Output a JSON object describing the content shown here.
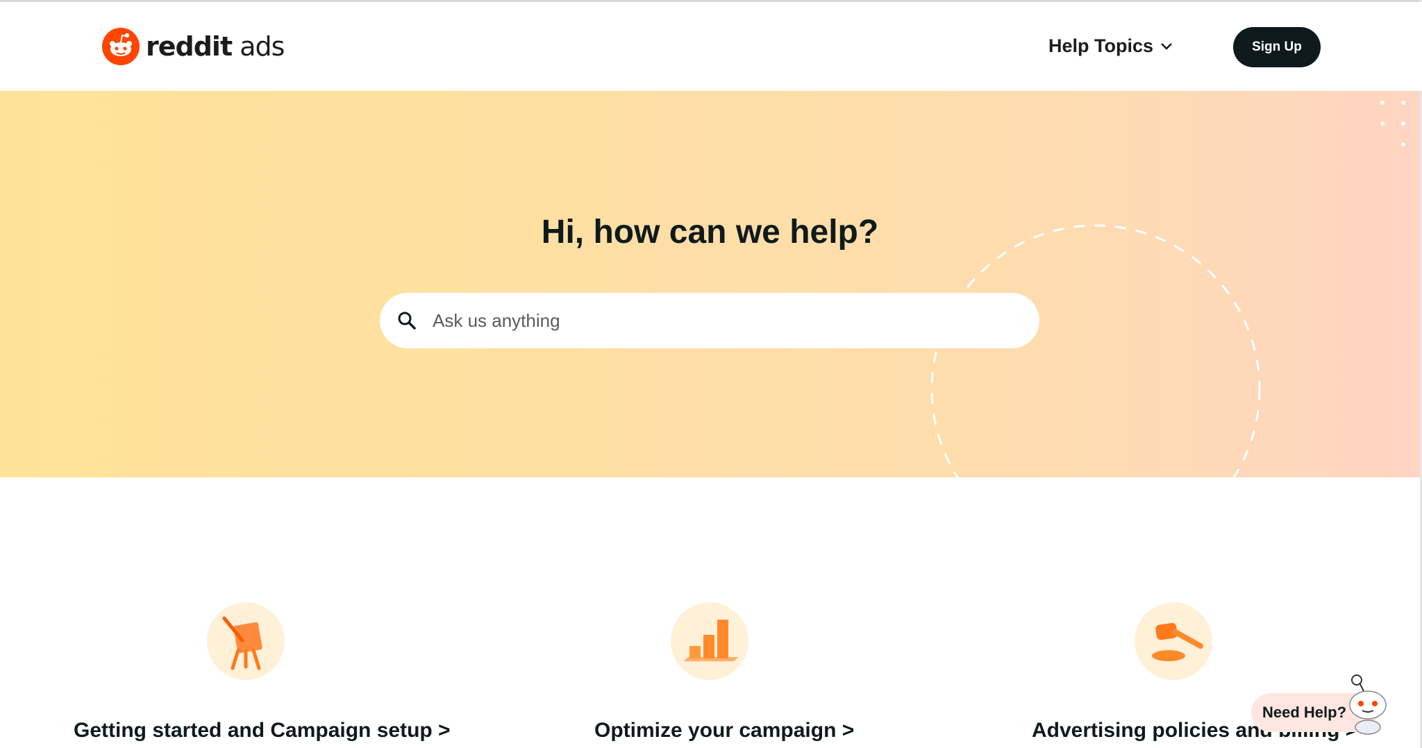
{
  "header": {
    "logo_text_brand": "reddit",
    "logo_text_product": "ads",
    "help_topics_label": "Help Topics",
    "signup_label": "Sign Up"
  },
  "hero": {
    "title": "Hi, how can we help?",
    "search_placeholder": "Ask us anything"
  },
  "categories": [
    {
      "label": "Getting started and Campaign setup >",
      "icon": "easel-icon"
    },
    {
      "label": "Optimize your campaign >",
      "icon": "bar-chart-icon"
    },
    {
      "label": "Advertising policies and billing >",
      "icon": "gavel-icon"
    }
  ],
  "support_widget": {
    "label": "Need Help?"
  },
  "colors": {
    "brand_orange": "#ff4500",
    "hero_gradient_start": "#ffe29a",
    "hero_gradient_end": "#fed5c2",
    "dark": "#0f1a1c"
  }
}
